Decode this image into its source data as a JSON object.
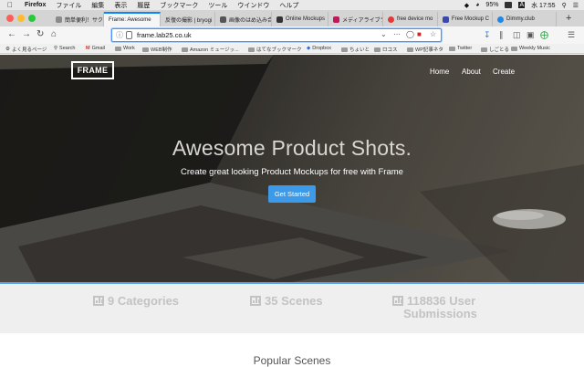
{
  "menubar": {
    "app": "Firefox",
    "items": [
      "ファイル",
      "編集",
      "表示",
      "履歴",
      "ブックマーク",
      "ツール",
      "ウインドウ",
      "ヘルプ"
    ],
    "battery": "95%",
    "input_mode": "A",
    "clock": "水 17:55"
  },
  "tabs": [
    {
      "label": "簡単便利！サク",
      "color": "#8a8a8a"
    },
    {
      "label": "Frame: Awesome",
      "color": "#ffffff"
    },
    {
      "label": "反復の撮影 | bryogi",
      "color": "#777777"
    },
    {
      "label": "画像のはめ込み合成",
      "color": "#555555"
    },
    {
      "label": "Online Mockups",
      "color": "#333333"
    },
    {
      "label": "メディアライブラ",
      "color": "#c2185b"
    },
    {
      "label": "free device mo",
      "color": "#e53935"
    },
    {
      "label": "Free Mockup C",
      "color": "#3949ab"
    },
    {
      "label": "Dimmy.club",
      "color": "#1e88e5"
    }
  ],
  "urlbar": {
    "url": "frame.lab25.co.uk"
  },
  "bookmarks": [
    "よく見るページ",
    "Search",
    "Gmail",
    "Work",
    "WEB制作",
    "Amazon ミュージッ...",
    "はてなブックマーク",
    "Dropbox",
    "ちょいと",
    "ロコス",
    "WP記事ネタ",
    "Twitter",
    "しごとる",
    "Weekly Music"
  ],
  "site": {
    "logo": "FRAME",
    "nav": [
      "Home",
      "About",
      "Create"
    ],
    "headline": "Awesome Product Shots.",
    "subline": "Create great looking Product Mockups for free with Frame",
    "cta": "Get Started",
    "stats": [
      {
        "line1": "9 Categories",
        "line2": ""
      },
      {
        "line1": "35 Scenes",
        "line2": ""
      },
      {
        "line1": "118836 User",
        "line2": "Submissions"
      }
    ],
    "popular_heading": "Popular Scenes"
  },
  "colors": {
    "accent": "#3d9ae8",
    "tab_active_border": "#0a84ff",
    "stat_text": "#c3c3c3"
  }
}
